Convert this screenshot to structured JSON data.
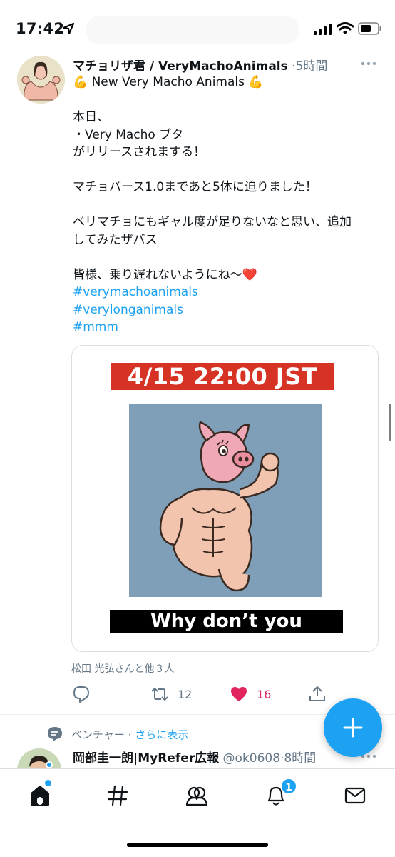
{
  "status_bar": {
    "time": "17:42"
  },
  "tweet1": {
    "display_name": "マチョリザ君 / VeryMachoAnimals",
    "separator": "·",
    "time_ago": "5時間",
    "lines": [
      "💪 New Very Macho Animals 💪",
      "",
      "本日、",
      "・Very Macho ブタ",
      "がリリースされまする！",
      "",
      "マチョバース1.0まであと5体に迫りました！",
      "",
      "ベリマチョにもギャル度が足りないなと思い、追加",
      "してみたザバス",
      "",
      "皆様、乗り遅れないようにね〜❤️"
    ],
    "hashtags": [
      "#verymachoanimals",
      "#verylonganimals",
      "#mmm"
    ],
    "media": {
      "date_banner": "4/15 22:00 JST",
      "caption": "Why don’t you macho?"
    },
    "liked_by": "松田 光弘さんと他３人",
    "retweet_count": "12",
    "like_count": "16"
  },
  "tweet2": {
    "topic": "ベンチャー",
    "topic_separator": "·",
    "topic_more": "さらに表示",
    "display_name": "岡部圭一朗|MyRefer広報",
    "handle": "@ok0608",
    "separator": "·",
    "time_ago": "8時間"
  },
  "nav": {
    "notification_badge": "1"
  },
  "colors": {
    "accent": "#1da1f2",
    "like": "#e0245e",
    "date_banner": "#d73324",
    "art_background": "#7e9fb7"
  }
}
